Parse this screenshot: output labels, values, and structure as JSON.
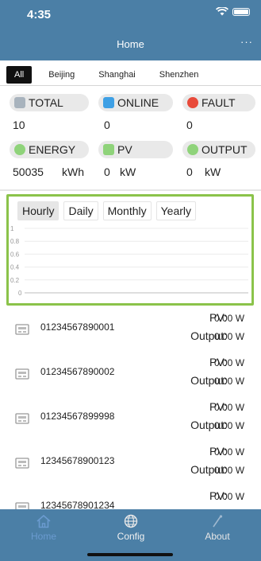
{
  "status_bar": {
    "time": "4:35"
  },
  "nav": {
    "title": "Home",
    "more": "···"
  },
  "tabs": [
    {
      "label": "All",
      "active": true
    },
    {
      "label": "Beijing",
      "active": false
    },
    {
      "label": "Shanghai",
      "active": false
    },
    {
      "label": "Shenzhen",
      "active": false
    }
  ],
  "stats": {
    "total": {
      "label": "TOTAL",
      "value": "10",
      "icon": "device-icon",
      "icon_color": "#a8b3bd"
    },
    "online": {
      "label": "ONLINE",
      "value": "0",
      "icon": "bus-icon",
      "icon_color": "#3ea0e5"
    },
    "fault": {
      "label": "FAULT",
      "value": "0",
      "icon": "alert-icon",
      "icon_color": "#e84a3a"
    },
    "energy": {
      "label": "ENERGY",
      "value": "50035",
      "unit": "kWh",
      "icon": "leaf-icon",
      "icon_color": "#8fd37a"
    },
    "pv": {
      "label": "PV",
      "value": "0",
      "unit": "kW",
      "icon": "solar-icon",
      "icon_color": "#8fd37a"
    },
    "output": {
      "label": "OUTPUT",
      "value": "0",
      "unit": "kW",
      "icon": "gauge-icon",
      "icon_color": "#8fd37a"
    }
  },
  "chart": {
    "periods": [
      "Hourly",
      "Daily",
      "Monthly",
      "Yearly"
    ],
    "active_period": "Hourly",
    "accent_color": "#8bc34a"
  },
  "chart_data": {
    "type": "line",
    "x": [],
    "series": [],
    "yticks": [
      "1",
      "0.8",
      "0.6",
      "0.4",
      "0.2",
      "0"
    ],
    "ylim": [
      0,
      1
    ],
    "grid": true
  },
  "devices": [
    {
      "id": "01234567890001",
      "pv_label": "PV:",
      "pv_value": "0.00 W",
      "output_label": "Output:",
      "output_value": "0.00 W"
    },
    {
      "id": "01234567890002",
      "pv_label": "PV:",
      "pv_value": "0.00 W",
      "output_label": "Output:",
      "output_value": "0.00 W"
    },
    {
      "id": "01234567899998",
      "pv_label": "PV:",
      "pv_value": "0.00 W",
      "output_label": "Output:",
      "output_value": "0.00 W"
    },
    {
      "id": "12345678900123",
      "pv_label": "PV:",
      "pv_value": "0.00 W",
      "output_label": "Output:",
      "output_value": "0.00 W"
    },
    {
      "id": "12345678901234",
      "pv_label": "PV:",
      "pv_value": "0.00 W"
    }
  ],
  "tabbar": {
    "items": [
      {
        "label": "Home",
        "icon": "home-icon",
        "selected": true
      },
      {
        "label": "Config",
        "icon": "globe-icon",
        "selected": false
      },
      {
        "label": "About",
        "icon": "about-icon",
        "selected": false
      }
    ]
  },
  "colors": {
    "brand": "#4b7fa6",
    "tab_active_bg": "#111111",
    "selected_tab": "#6b9bd0"
  }
}
